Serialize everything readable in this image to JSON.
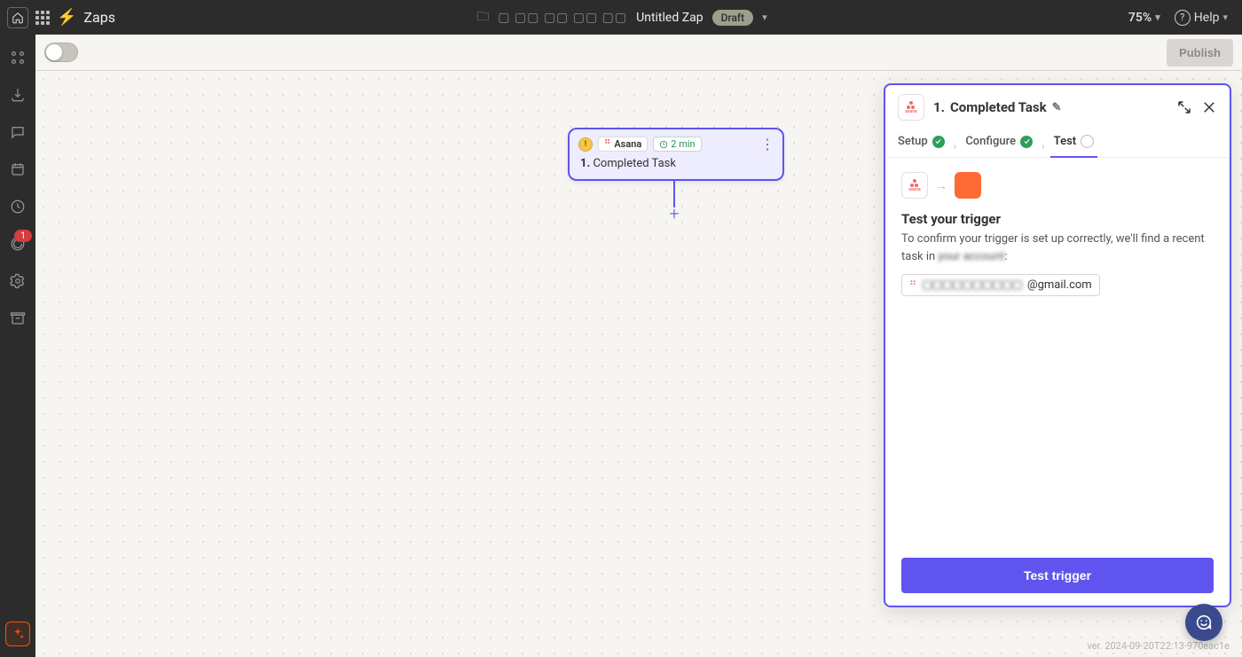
{
  "header": {
    "section": "Zaps",
    "folder_path_obscured": "▢ ▢▢ ▢▢ ▢▢ ▢▢",
    "zap_name": "Untitled Zap",
    "status_chip": "Draft",
    "zoom": "75%",
    "help_label": "Help"
  },
  "toolbar": {
    "publish_label": "Publish"
  },
  "leftrail": {
    "badge_count": "1"
  },
  "canvas_node": {
    "app_name": "Asana",
    "polling": "2 min",
    "step_number": "1.",
    "step_title": "Completed Task"
  },
  "panel": {
    "title_prefix": "1.",
    "title": "Completed Task",
    "steps": {
      "setup": "Setup",
      "configure": "Configure",
      "test": "Test"
    },
    "test": {
      "heading": "Test your trigger",
      "description_prefix": "To confirm your trigger is set up correctly, we'll find a recent task in ",
      "description_account_obscured": "your account",
      "description_suffix": ":",
      "account_email_obscured": "▢▢▢▢▢▢▢▢▢▢",
      "account_email_suffix": "@gmail.com",
      "cta": "Test trigger"
    }
  },
  "footer": {
    "version": "ver. 2024-09-20T22:13-970eac1e"
  }
}
